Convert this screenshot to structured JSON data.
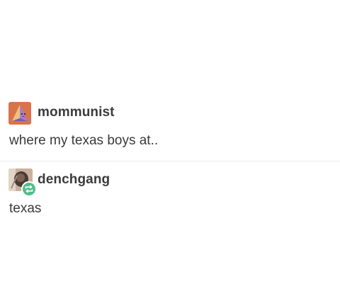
{
  "posts": [
    {
      "username": "mommunist",
      "text": "where my texas boys at..",
      "avatar_icon": "triangle-face-icon",
      "avatar_color": "#d9734a"
    },
    {
      "username": "denchgang",
      "text": "texas",
      "avatar_icon": "photo-avatar",
      "badge_icon": "reblog-icon",
      "badge_color": "#52bd8c"
    }
  ]
}
